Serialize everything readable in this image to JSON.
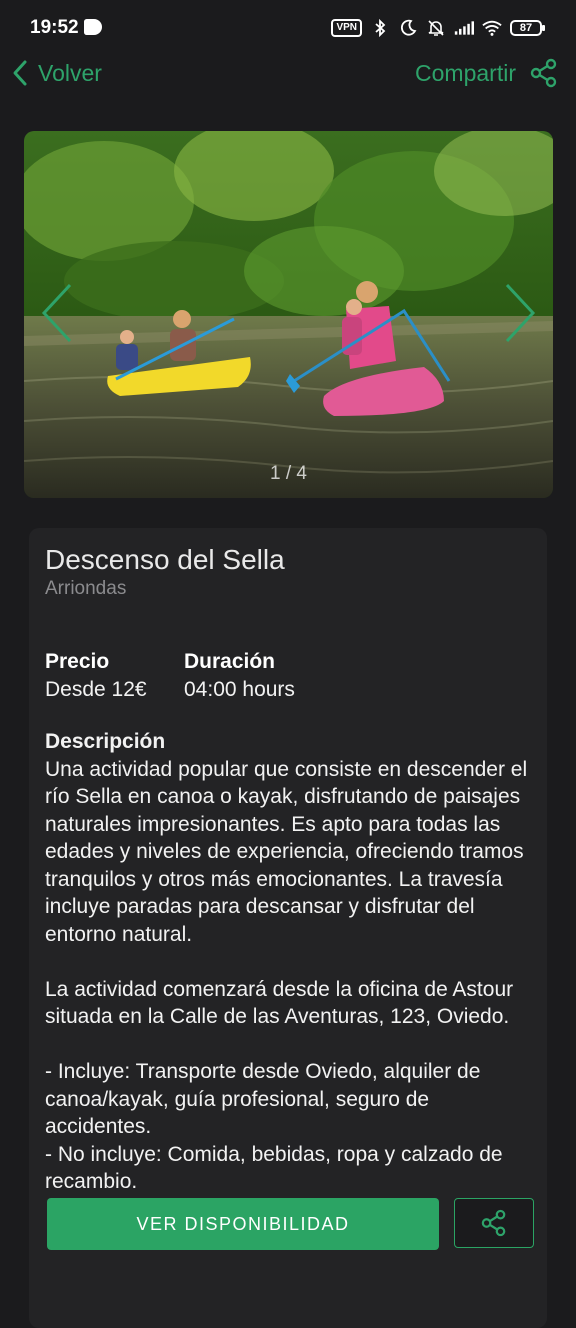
{
  "status_bar": {
    "time": "19:52",
    "vpn": "VPN",
    "battery": "87"
  },
  "nav": {
    "back_label": "Volver",
    "share_label": "Compartir"
  },
  "carousel": {
    "counter": "1 / 4",
    "current": 1,
    "total": 4
  },
  "activity": {
    "title": "Descenso del Sella",
    "location": "Arriondas",
    "price_label": "Precio",
    "price_value": "Desde 12€",
    "duration_label": "Duración",
    "duration_value": "04:00 hours",
    "description_label": "Descripción",
    "description_p1": "Una actividad popular que consiste en descender el río Sella en canoa o kayak, disfrutando de paisajes naturales impresionantes. Es apto para todas las edades y niveles de experiencia, ofreciendo tramos tranquilos y otros más emocionantes. La travesía incluye paradas para descansar y disfrutar del entorno natural.",
    "description_p2": "La actividad comenzará desde la oficina de Astour situada en la Calle de las Aventuras, 123, Oviedo.",
    "description_p3": "- Incluye: Transporte desde Oviedo, alquiler de canoa/kayak, guía profesional, seguro de accidentes.",
    "description_p4": "- No incluye: Comida, bebidas, ropa y calzado de recambio."
  },
  "actions": {
    "availability_label": "VER DISPONIBILIDAD"
  },
  "colors": {
    "accent": "#2ea36a",
    "background": "#1b1b1d",
    "card": "#232325"
  },
  "icons": {
    "back": "chevron-left-icon",
    "share": "share-icon",
    "prev": "chevron-left-icon",
    "next": "chevron-right-icon"
  }
}
